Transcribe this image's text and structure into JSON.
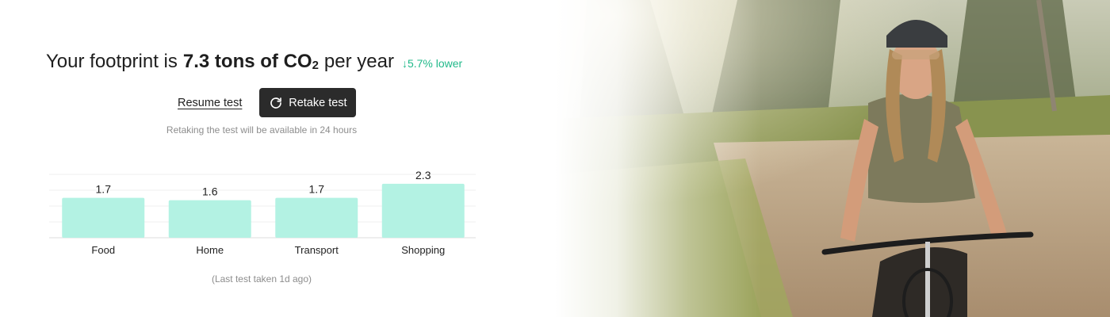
{
  "headline": {
    "prefix": "Your footprint is",
    "amount": "7.3 tons of CO",
    "subscript": "2",
    "suffix": "per year",
    "delta": "↓5.7% lower"
  },
  "actions": {
    "resume_label": "Resume test",
    "retake_label": "Retake test"
  },
  "notice": "Retaking the test will be available in 24 hours",
  "last_test": "(Last test taken 1d ago)",
  "colors": {
    "bar": "#b3f2e3",
    "delta": "#21b98a",
    "button": "#2b2b2b"
  },
  "photo": {
    "description_icon": "cyclist-photo"
  },
  "chart_data": {
    "type": "bar",
    "categories": [
      "Food",
      "Home",
      "Transport",
      "Shopping"
    ],
    "values": [
      1.7,
      1.6,
      1.7,
      2.3
    ],
    "title": "",
    "xlabel": "",
    "ylabel": "",
    "ylim": [
      0,
      2.7
    ],
    "grid": true
  }
}
